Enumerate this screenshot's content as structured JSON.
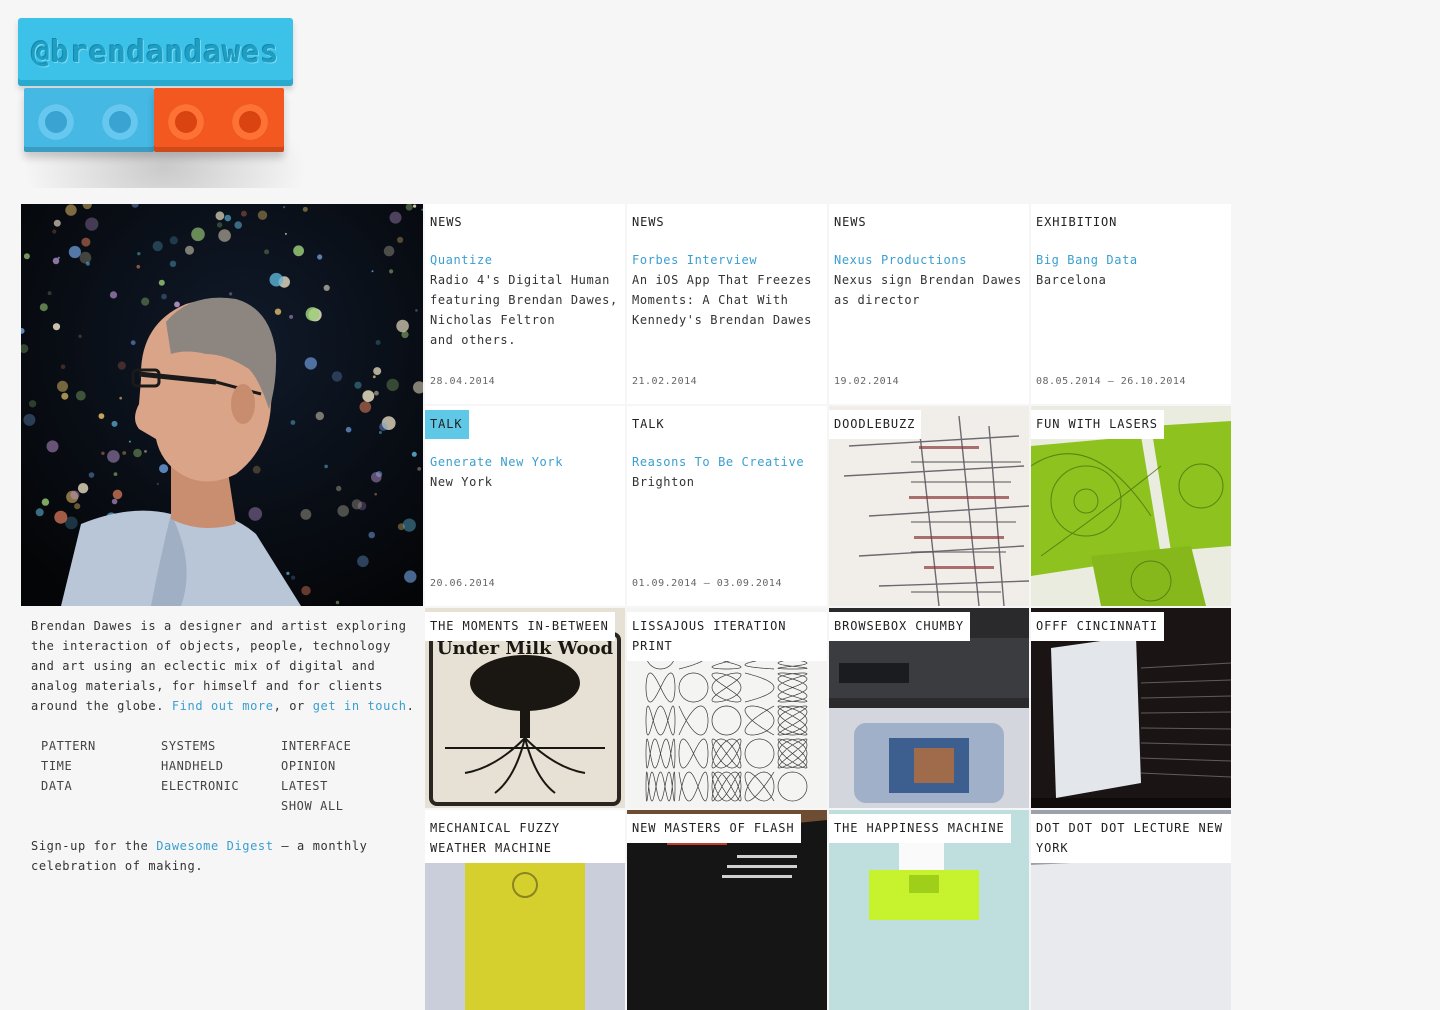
{
  "logo": {
    "text": "@brendandawes"
  },
  "hero": {
    "alt": "Portrait of Brendan Dawes"
  },
  "intro": {
    "text_before": "Brendan Dawes is a designer and artist exploring the interaction of objects, people, technology and art using an eclectic mix of digital and analog materials, for himself and for clients around the globe. ",
    "link_more": "Find out more",
    "text_middle": ", or ",
    "link_touch": "get in touch",
    "text_end": "."
  },
  "categories": {
    "col1": [
      "PATTERN",
      "TIME",
      "DATA"
    ],
    "col2": [
      "SYSTEMS",
      "HANDHELD",
      "ELECTRONIC"
    ],
    "col3": [
      "INTERFACE",
      "OPINION",
      "LATEST",
      "SHOW ALL"
    ]
  },
  "signup": {
    "text_before": "Sign-up for the ",
    "link": "Dawesome Digest",
    "text_after": " – a monthly celebration of making."
  },
  "cards": [
    {
      "tag": "NEWS",
      "title": "Quantize",
      "desc": "Radio 4's Digital Human featuring Brendan Dawes, Nicholas Feltron\nand others.",
      "date": "28.04.2014"
    },
    {
      "tag": "NEWS",
      "title": "Forbes Interview",
      "desc": "An iOS App That Freezes Moments: A Chat With Kennedy's Brendan Dawes",
      "date": "21.02.2014"
    },
    {
      "tag": "NEWS",
      "title": "Nexus Productions",
      "desc": "Nexus sign Brendan Dawes as director",
      "date": "19.02.2014"
    },
    {
      "tag": "EXHIBITION",
      "title": "Big Bang Data",
      "desc": "Barcelona",
      "date": "08.05.2014 – 26.10.2014"
    },
    {
      "tag": "TALK",
      "title": "Generate New York",
      "desc": "New York",
      "date": "20.06.2014"
    },
    {
      "tag": "TALK",
      "title": "Reasons To Be Creative",
      "desc": "Brighton",
      "date": "01.09.2014 – 03.09.2014"
    }
  ],
  "projects": [
    {
      "label": "DOODLEBUZZ"
    },
    {
      "label": "FUN WITH LASERS"
    },
    {
      "label": "THE MOMENTS IN-BETWEEN",
      "image_text": "Under Milk Wood"
    },
    {
      "label": "LISSAJOUS ITERATION PRINT"
    },
    {
      "label": "BROWSEBOX CHUMBY"
    },
    {
      "label": "OFFF CINCINNATI"
    },
    {
      "label": "MECHANICAL FUZZY WEATHER MACHINE"
    },
    {
      "label": "NEW MASTERS OF FLASH"
    },
    {
      "label": "THE HAPPINESS MACHINE"
    },
    {
      "label": "DOT DOT DOT LECTURE NEW YORK"
    }
  ]
}
